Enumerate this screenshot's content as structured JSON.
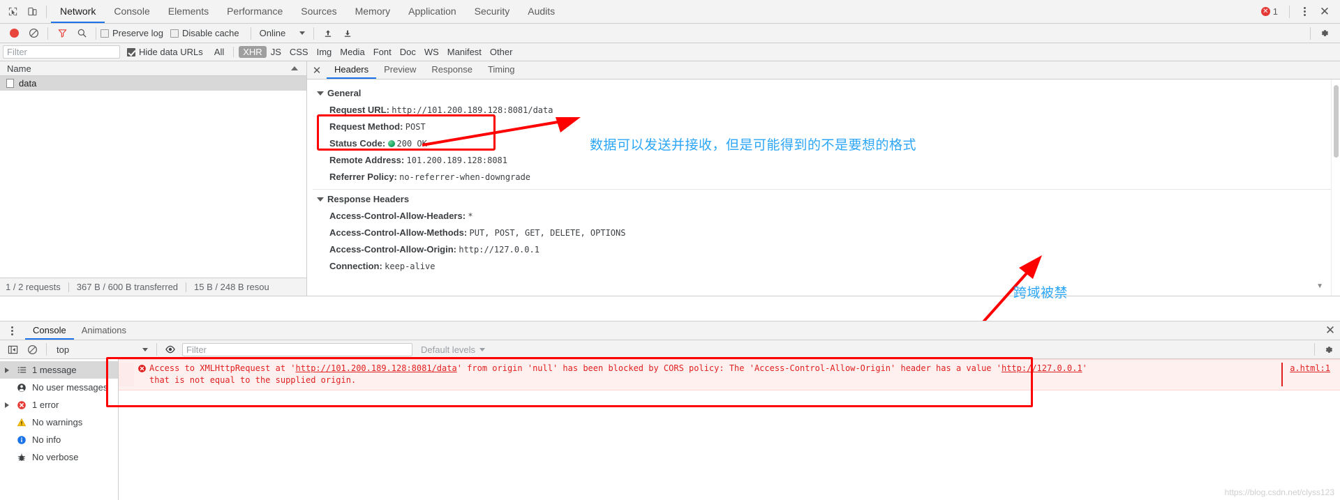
{
  "toolbar": {
    "inspect_icon": "inspect-cursor-icon",
    "device_icon": "device-toolbar-icon",
    "tabs": [
      {
        "label": "Network",
        "active": true
      },
      {
        "label": "Console",
        "active": false
      },
      {
        "label": "Elements",
        "active": false
      },
      {
        "label": "Performance",
        "active": false
      },
      {
        "label": "Sources",
        "active": false
      },
      {
        "label": "Memory",
        "active": false
      },
      {
        "label": "Application",
        "active": false
      },
      {
        "label": "Security",
        "active": false
      },
      {
        "label": "Audits",
        "active": false
      }
    ],
    "error_count": "1",
    "more_label": "⋮",
    "close_label": "✕"
  },
  "network_toolbar": {
    "record_icon": "record-button-icon",
    "clear_icon": "clear-icon",
    "filter_icon": "filter-funnel-icon",
    "search_icon": "search-icon",
    "preserve_log_label": "Preserve log",
    "preserve_log_checked": false,
    "disable_cache_label": "Disable cache",
    "disable_cache_checked": false,
    "throttle_value": "Online",
    "import_icon": "import-har-icon",
    "export_icon": "export-har-icon",
    "settings_icon": "gear-icon"
  },
  "filter_bar": {
    "filter_placeholder": "Filter",
    "filter_value": "",
    "hide_data_urls_label": "Hide data URLs",
    "hide_data_urls_checked": true,
    "types": [
      {
        "label": "All",
        "active": false
      },
      {
        "label": "XHR",
        "active": true
      },
      {
        "label": "JS",
        "active": false
      },
      {
        "label": "CSS",
        "active": false
      },
      {
        "label": "Img",
        "active": false
      },
      {
        "label": "Media",
        "active": false
      },
      {
        "label": "Font",
        "active": false
      },
      {
        "label": "Doc",
        "active": false
      },
      {
        "label": "WS",
        "active": false
      },
      {
        "label": "Manifest",
        "active": false
      },
      {
        "label": "Other",
        "active": false
      }
    ]
  },
  "request_list": {
    "column_header": "Name",
    "rows": [
      {
        "name": "data"
      }
    ],
    "status": {
      "requests": "1 / 2 requests",
      "transferred": "367 B / 600 B transferred",
      "resources": "15 B / 248 B resou"
    }
  },
  "details": {
    "close_label": "✕",
    "tabs": [
      {
        "label": "Headers",
        "active": true
      },
      {
        "label": "Preview",
        "active": false
      },
      {
        "label": "Response",
        "active": false
      },
      {
        "label": "Timing",
        "active": false
      }
    ],
    "general": {
      "title": "General",
      "items": [
        {
          "key": "Request URL:",
          "value": "http://101.200.189.128:8081/data"
        },
        {
          "key": "Request Method:",
          "value": "POST"
        },
        {
          "key": "Status Code:",
          "value": "200 OK",
          "status_dot": "#0f9d58"
        },
        {
          "key": "Remote Address:",
          "value": "101.200.189.128:8081"
        },
        {
          "key": "Referrer Policy:",
          "value": "no-referrer-when-downgrade"
        }
      ]
    },
    "response_headers": {
      "title": "Response Headers",
      "items": [
        {
          "key": "Access-Control-Allow-Headers:",
          "value": "*"
        },
        {
          "key": "Access-Control-Allow-Methods:",
          "value": "PUT, POST, GET, DELETE, OPTIONS"
        },
        {
          "key": "Access-Control-Allow-Origin:",
          "value": "http://127.0.0.1"
        },
        {
          "key": "Connection:",
          "value": "keep-alive"
        }
      ]
    }
  },
  "annotations": {
    "accent_color": "#2ca6f5",
    "highlight_color": "#ff0000",
    "note_top": "数据可以发送并接收，但是可能得到的不是要想的格式",
    "note_bottom": "跨域被禁"
  },
  "drawer": {
    "more_label": "⋮",
    "tabs": [
      {
        "label": "Console",
        "active": true
      },
      {
        "label": "Animations",
        "active": false
      }
    ],
    "close_label": "✕",
    "sidebar_toggle_icon": "sidebar-toggle-icon",
    "clear_console_icon": "clear-console-icon",
    "context_value": "top",
    "eye_icon": "live-expression-eye-icon",
    "filter_placeholder": "Filter",
    "filter_value": "",
    "levels_label": "Default levels",
    "settings_icon": "gear-icon",
    "sidebar_items": [
      {
        "label": "1 message",
        "icon": "list-icon",
        "selected": true,
        "expandable": true
      },
      {
        "label": "No user messages",
        "icon": "user-icon",
        "selected": false,
        "expandable": false
      },
      {
        "label": "1 error",
        "icon": "error-icon",
        "selected": false,
        "expandable": true
      },
      {
        "label": "No warnings",
        "icon": "warning-icon",
        "selected": false,
        "expandable": false
      },
      {
        "label": "No info",
        "icon": "info-icon",
        "selected": false,
        "expandable": false
      },
      {
        "label": "No verbose",
        "icon": "verbose-bug-icon",
        "selected": false,
        "expandable": false
      }
    ],
    "message": {
      "icon": "error-icon",
      "part1": "Access to XMLHttpRequest at '",
      "link1": "http://101.200.189.128:8081/data",
      "part2": "' from origin 'null' has been blocked by CORS policy: The 'Access-Control-Allow-Origin' header has a value '",
      "link2": "http://127.0.0.1",
      "part3": "'",
      "line2": "that is not equal to the supplied origin.",
      "source": "a.html:1"
    }
  },
  "watermark": "https://blog.csdn.net/clyss123"
}
